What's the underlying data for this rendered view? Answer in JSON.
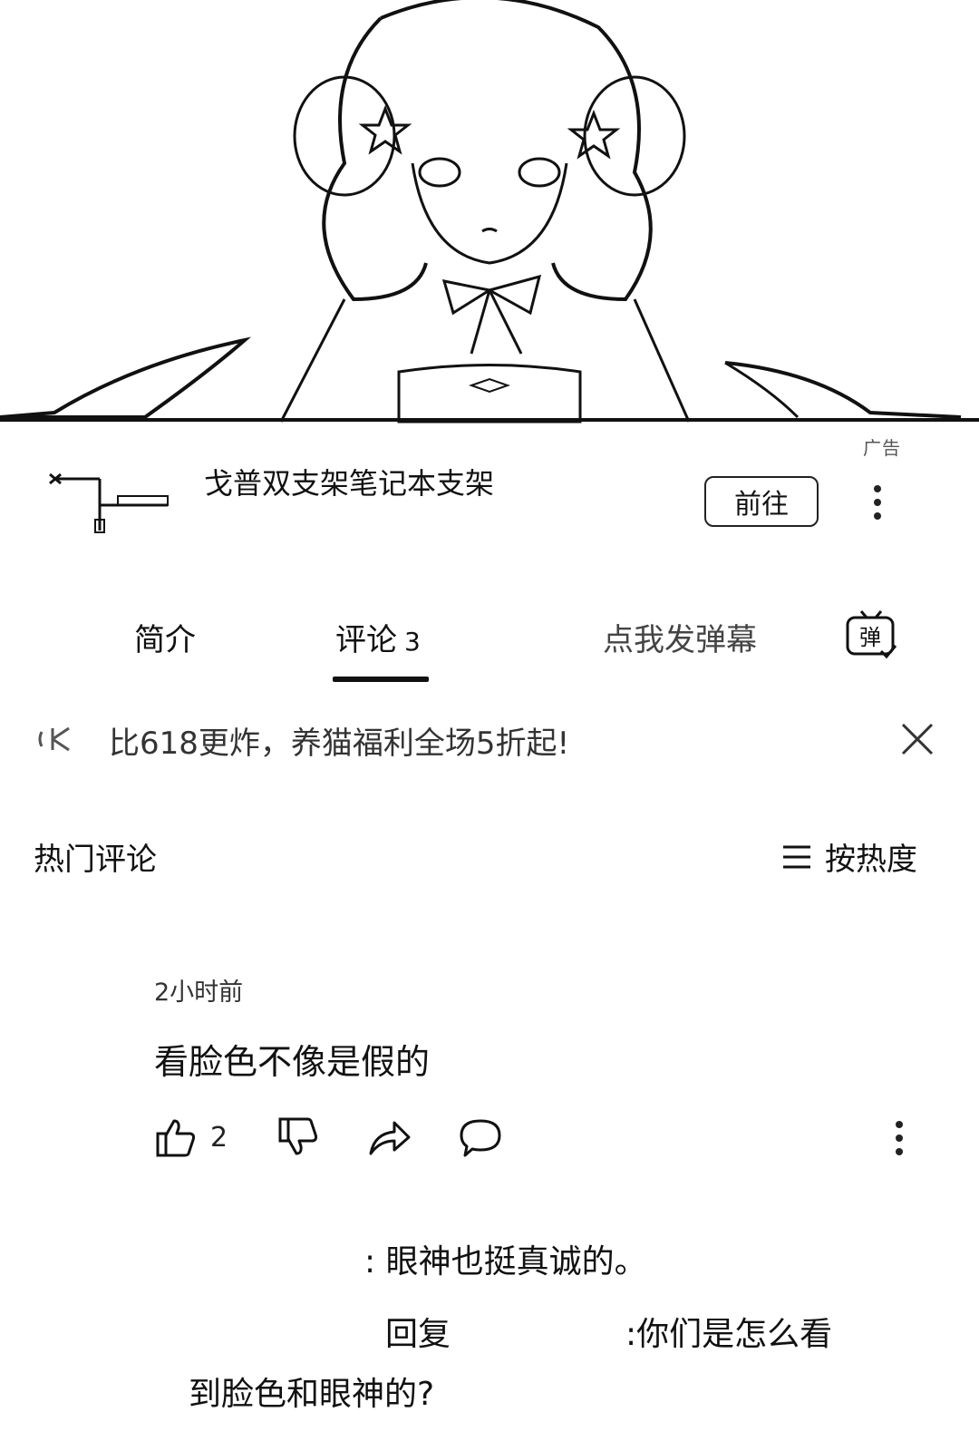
{
  "ad": {
    "title": "戈普双支架笔记本支架",
    "go_button": "前往",
    "label": "广告"
  },
  "tabs": [
    {
      "label": "简介",
      "count": ""
    },
    {
      "label": "评论",
      "count": "3"
    }
  ],
  "danmaku": {
    "placeholder": "点我发弹幕",
    "icon_label": "弹"
  },
  "promo": {
    "text": "比618更炸，养猫福利全场5折起!"
  },
  "comments_header": {
    "title": "热门评论",
    "sort_label": "按热度"
  },
  "comment": {
    "time": "2小时前",
    "content": "看脸色不像是假的",
    "likes": "2"
  },
  "replies": {
    "r1": ": 眼神也挺真诚的。",
    "r2_prefix": "回复",
    "r2_text": ":你们是怎么看",
    "r2_cont": "到脸色和眼神的?"
  },
  "colors": {
    "background": "#ffffff",
    "text": "#111111"
  }
}
